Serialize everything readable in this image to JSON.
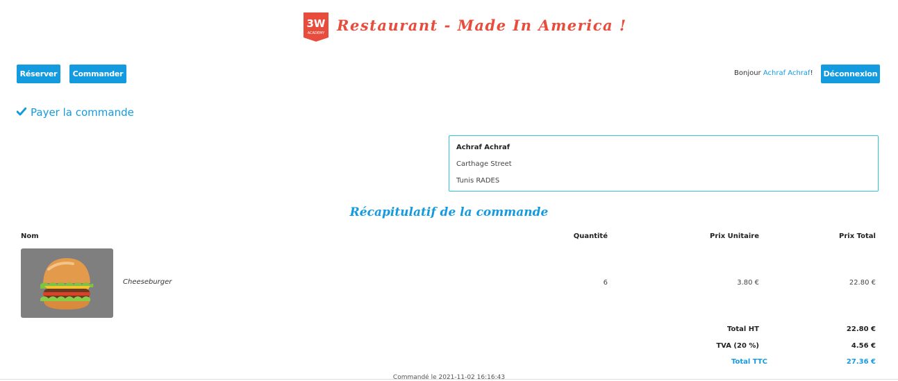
{
  "header": {
    "logo_text": "3W",
    "logo_subtext": "ACADEMY",
    "title": "Restaurant - Made In America !"
  },
  "nav": {
    "reserve_label": "Réserver",
    "order_label": "Commander",
    "greeting_prefix": "Bonjour",
    "user_name": "Achraf Achraf",
    "greeting_suffix": "!",
    "logout_label": "Déconnexion"
  },
  "payment": {
    "title": "Payer la commande",
    "icon": "check-icon"
  },
  "address": {
    "name": "Achraf Achraf",
    "street": "Carthage Street",
    "city": "Tunis RADES"
  },
  "recap": {
    "title": "Récapitulatif de la commande",
    "columns": {
      "name": "Nom",
      "quantity": "Quantité",
      "unit_price": "Prix Unitaire",
      "total_price": "Prix Total"
    },
    "items": [
      {
        "name": "Cheeseburger",
        "quantity": "6",
        "unit_price": "3.80 €",
        "total_price": "22.80 €"
      }
    ],
    "totals": {
      "ht_label": "Total HT",
      "ht_value": "22.80 €",
      "tva_label": "TVA (20 %)",
      "tva_value": "4.56 €",
      "ttc_label": "Total TTC",
      "ttc_value": "27.36 €"
    },
    "order_date": "Commandé le 2021-11-02 16:16:43"
  },
  "colors": {
    "accent": "#149bdf",
    "brand_red": "#e74c3c",
    "border_cyan": "#2ec4d6"
  }
}
